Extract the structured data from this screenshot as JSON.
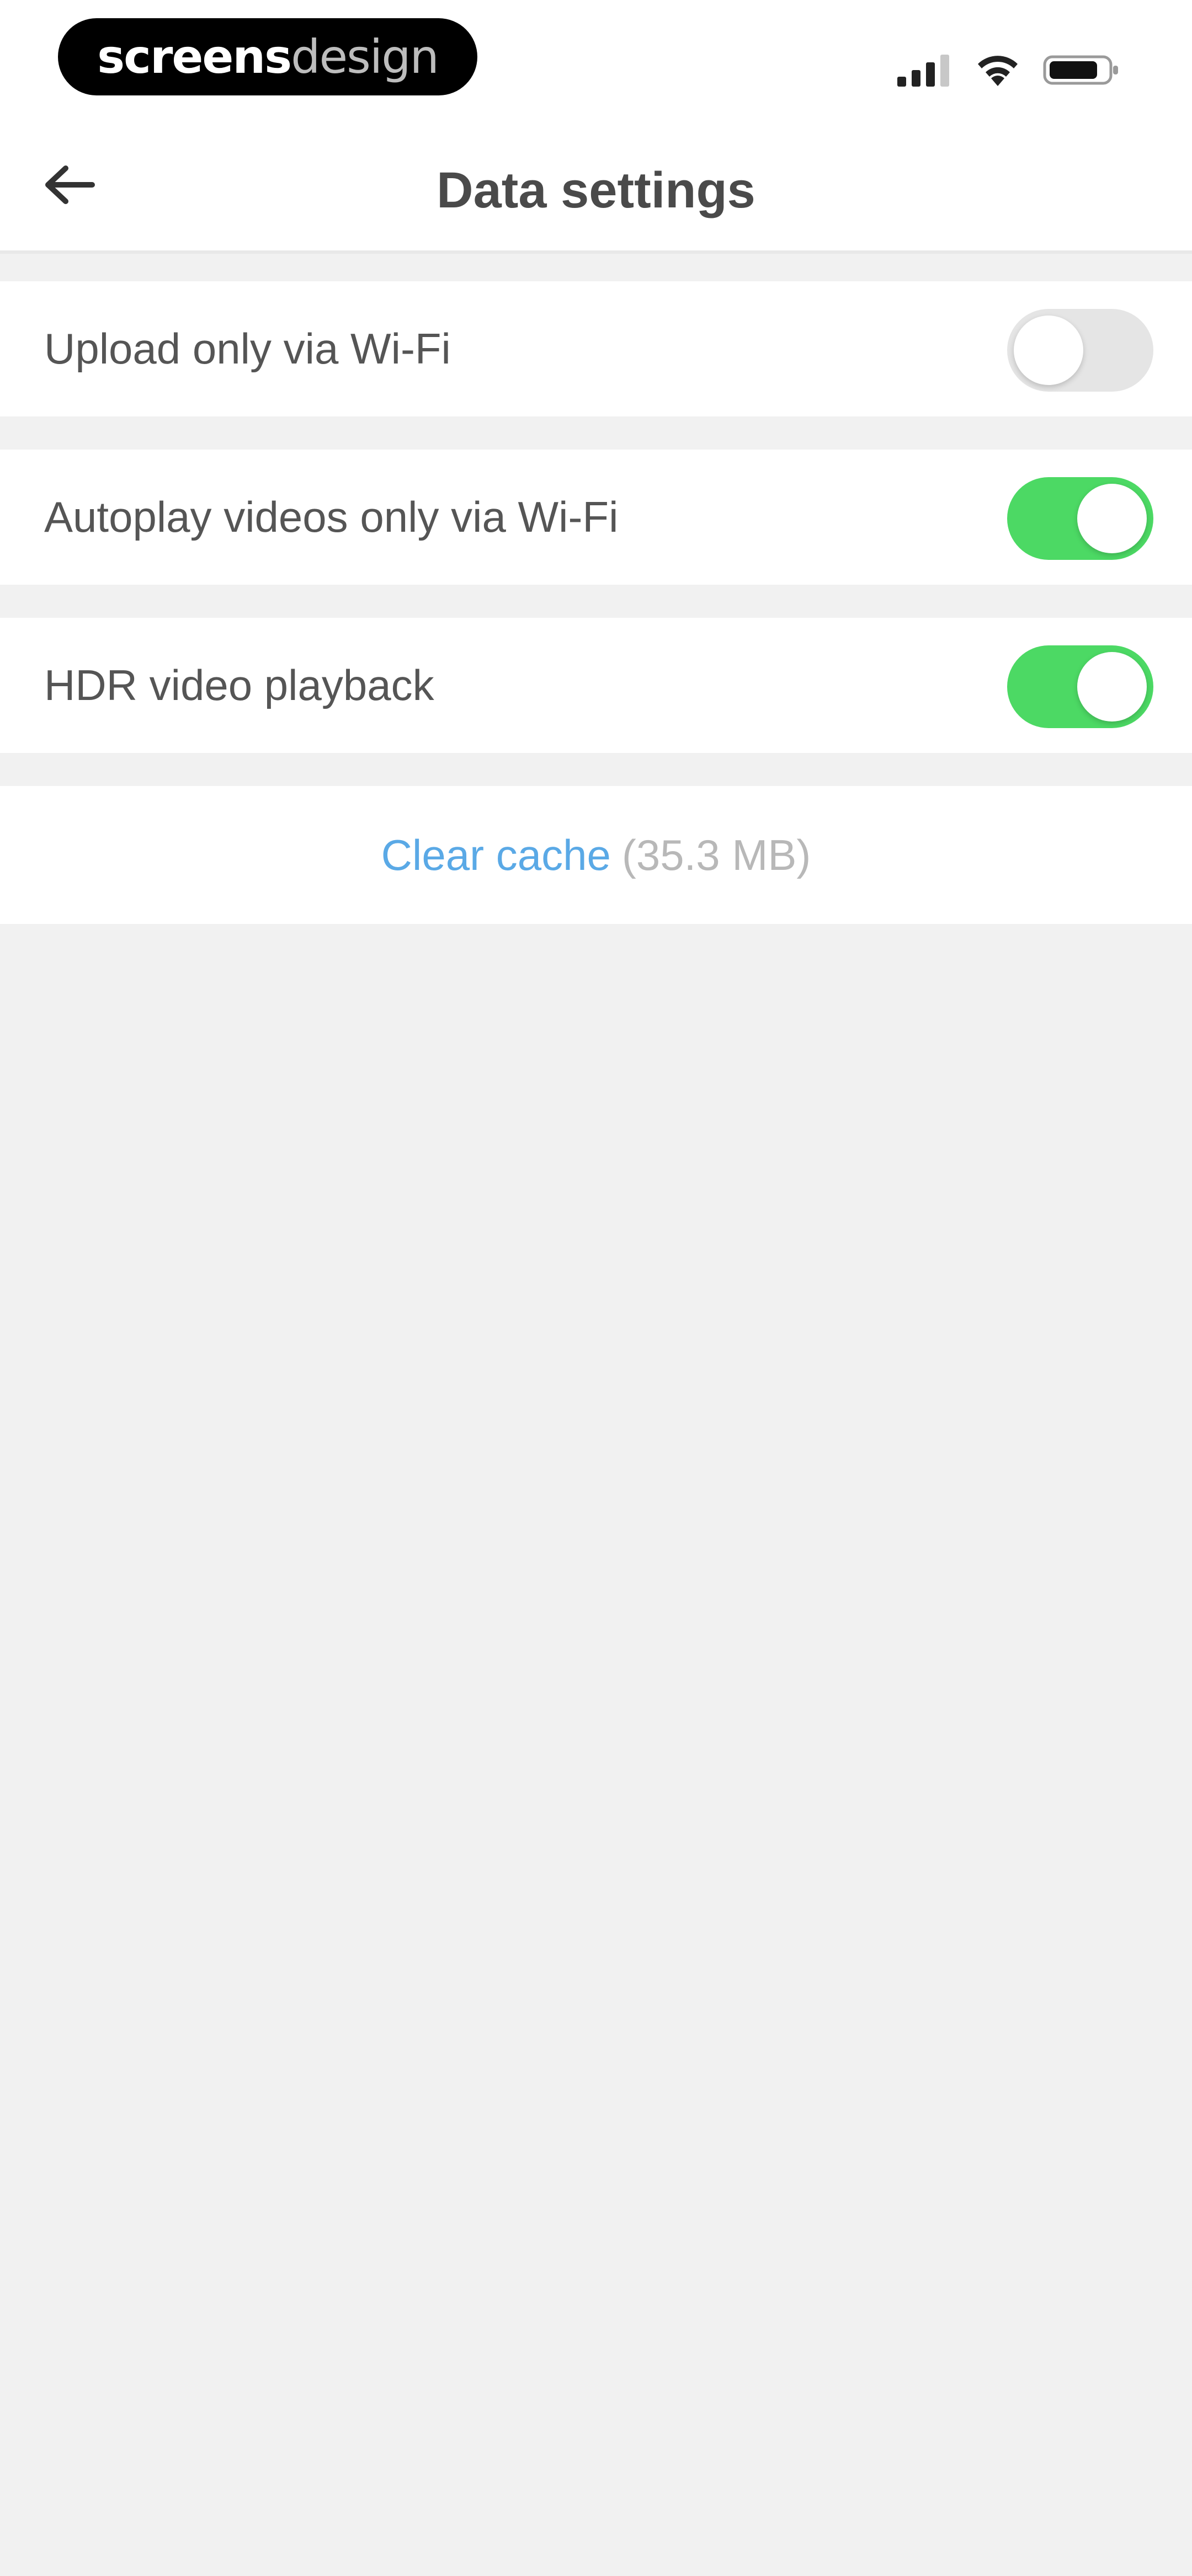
{
  "status_bar": {
    "brand_bold": "screens",
    "brand_light": "design",
    "icons": [
      "signal-icon",
      "wifi-icon",
      "battery-icon"
    ]
  },
  "nav": {
    "back_icon": "arrow-left-icon",
    "title": "Data settings"
  },
  "settings": [
    {
      "label": "Upload only via Wi-Fi",
      "enabled": false
    },
    {
      "label": "Autoplay videos only via Wi-Fi",
      "enabled": true
    },
    {
      "label": "HDR video playback",
      "enabled": true
    }
  ],
  "cache": {
    "link_label": "Clear cache",
    "size_open": "(",
    "size": "35.3 MB",
    "size_close": ")"
  },
  "colors": {
    "toggle_on": "#4cd964",
    "toggle_off": "#e5e5e5",
    "link": "#5aa9e6",
    "background": "#f1f1f1"
  }
}
